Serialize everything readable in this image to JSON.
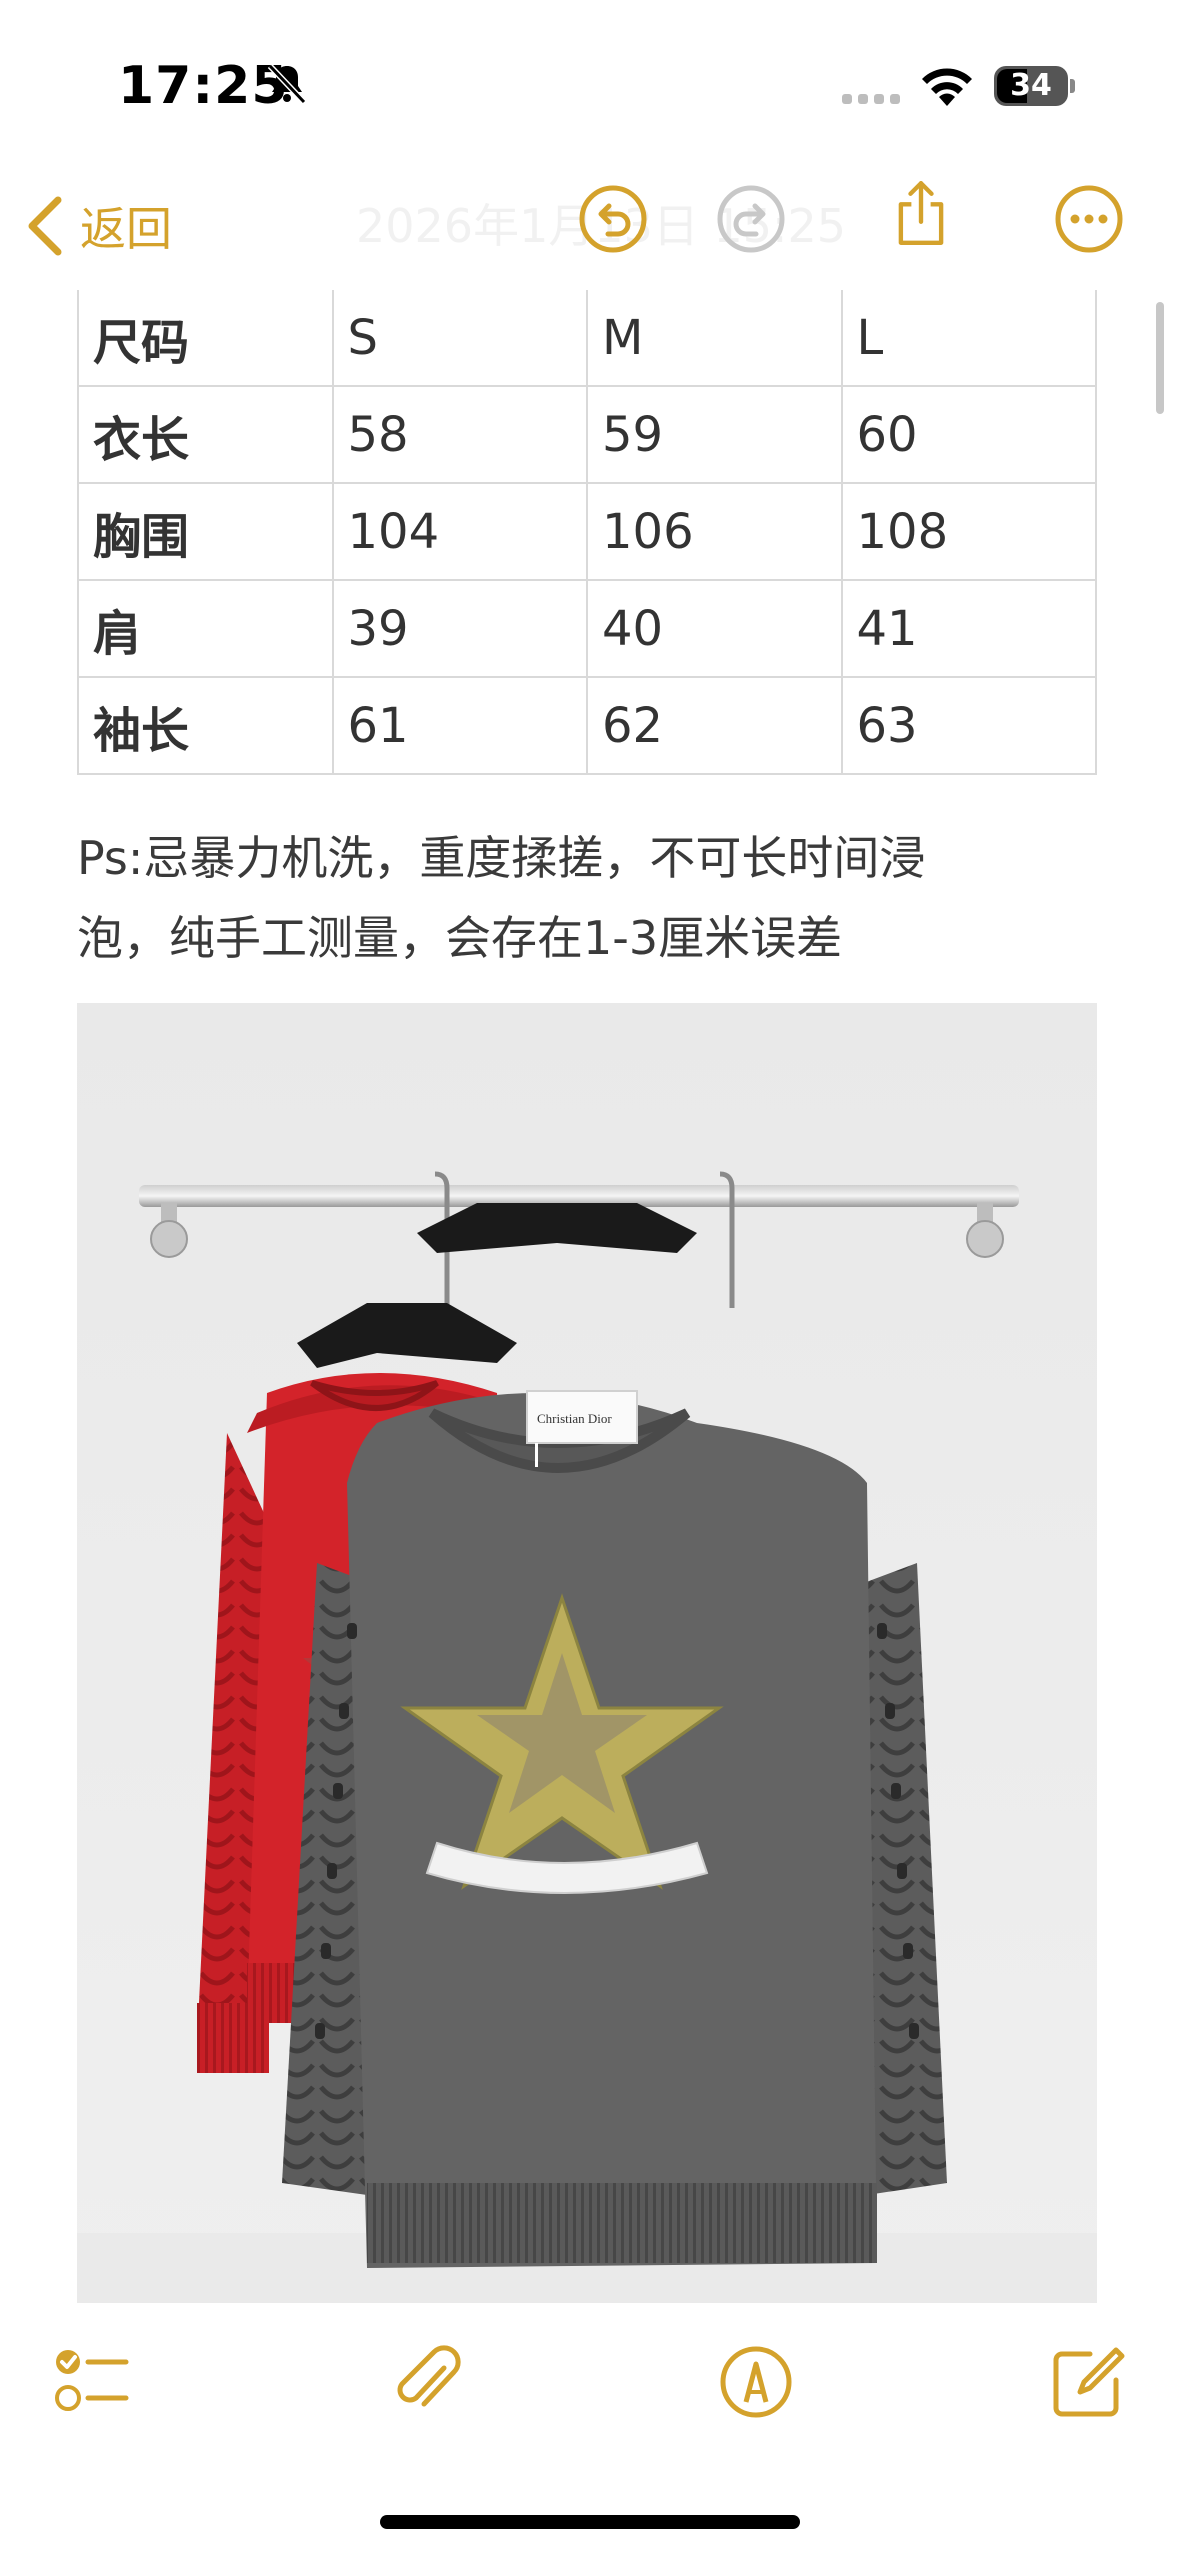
{
  "status_bar": {
    "time": "17:25",
    "battery": "34"
  },
  "nav": {
    "back_label": "返回",
    "title_ghost": "2026年1月13日 15:25"
  },
  "size_table": {
    "rows": [
      [
        "尺码",
        "S",
        "M",
        "L"
      ],
      [
        "衣长",
        "58",
        "59",
        "60"
      ],
      [
        "胸围",
        "104",
        "106",
        "108"
      ],
      [
        "肩",
        "39",
        "40",
        "41"
      ],
      [
        "袖长",
        "61",
        "62",
        "63"
      ]
    ]
  },
  "note": {
    "line1": "Ps:忌暴力机洗，重度揉搓，不可长时间浸",
    "line2": "泡，纯手工测量，会存在1-3厘米误差"
  },
  "photo": {
    "tag_text": "Christian Dior"
  },
  "colors": {
    "accent": "#D4A22C",
    "red_sweater": "#d3232a",
    "gray_sweater": "#636363"
  },
  "icons": [
    "bell-slash-icon",
    "cellular-signal-icon",
    "wifi-icon",
    "battery-icon",
    "chevron-left-icon",
    "undo-icon",
    "redo-icon",
    "share-icon",
    "more-icon",
    "checklist-icon",
    "paperclip-icon",
    "markup-icon",
    "compose-icon"
  ]
}
